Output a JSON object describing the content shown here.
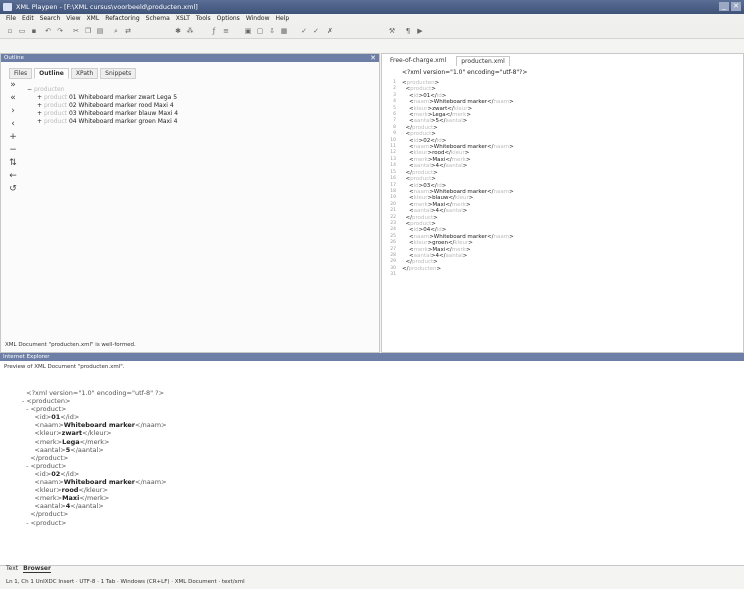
{
  "window": {
    "title": "XML Playpen - [F:\\XML cursus\\voorbeeld\\producten.xml]"
  },
  "menu": [
    "File",
    "Edit",
    "Search",
    "View",
    "XML",
    "Refactoring",
    "Schema",
    "XSLT",
    "Tools",
    "Options",
    "Window",
    "Help"
  ],
  "left_panel": {
    "title": "Outline",
    "tabs": [
      "Files",
      "Outline",
      "XPath",
      "Snippets"
    ],
    "active_tab": "Outline",
    "outline_root": "producten",
    "outline_items": [
      {
        "tag": "product",
        "text": "01 Whiteboard marker zwart Lega 5"
      },
      {
        "tag": "product",
        "text": "02 Whiteboard marker rood Maxi 4"
      },
      {
        "tag": "product",
        "text": "03 Whiteboard marker blauw Maxi 4"
      },
      {
        "tag": "product",
        "text": "04 Whiteboard marker groen Maxi 4"
      }
    ],
    "status": "XML Document \"producten.xml\" is well-formed."
  },
  "editor": {
    "tabs": [
      "Free-of-charge.xml",
      "producten.xml"
    ],
    "active_tab": "producten.xml",
    "header": "<?xml version=\"1.0\" encoding=\"utf-8\"?>",
    "lines": [
      [
        "",
        "",
        ""
      ],
      [
        "<",
        "producten",
        ">"
      ],
      [
        "  <",
        "product",
        ">"
      ],
      [
        "    <",
        "id",
        ">01</",
        "id",
        ">"
      ],
      [
        "    <",
        "naam",
        ">Whiteboard marker</",
        "naam",
        ">"
      ],
      [
        "    <",
        "kleur",
        ">zwart</",
        "kleur",
        ">"
      ],
      [
        "    <",
        "merk",
        ">Lega</",
        "merk",
        ">"
      ],
      [
        "    <",
        "aantal",
        ">5</",
        "aantal",
        ">"
      ],
      [
        "  </",
        "product",
        ">"
      ],
      [
        "  <",
        "product",
        ">"
      ],
      [
        "    <",
        "id",
        ">02</",
        "id",
        ">"
      ],
      [
        "    <",
        "naam",
        ">Whiteboard marker</",
        "naam",
        ">"
      ],
      [
        "    <",
        "kleur",
        ">rood</",
        "kleur",
        ">"
      ],
      [
        "    <",
        "merk",
        ">Maxi</",
        "merk",
        ">"
      ],
      [
        "    <",
        "aantal",
        ">4</",
        "aantal",
        ">"
      ],
      [
        "  </",
        "product",
        ">"
      ],
      [
        "  <",
        "product",
        ">"
      ],
      [
        "    <",
        "id",
        ">03</",
        "id",
        ">"
      ],
      [
        "    <",
        "naam",
        ">Whiteboard marker</",
        "naam",
        ">"
      ],
      [
        "    <",
        "kleur",
        ">blauw</",
        "kleur",
        ">"
      ],
      [
        "    <",
        "merk",
        ">Maxi</",
        "merk",
        ">"
      ],
      [
        "    <",
        "aantal",
        ">4</",
        "aantal",
        ">"
      ],
      [
        "  </",
        "product",
        ">"
      ],
      [
        "  <",
        "product",
        ">"
      ],
      [
        "    <",
        "id",
        ">04</",
        "id",
        ">"
      ],
      [
        "    <",
        "naam",
        ">Whiteboard marker</",
        "naam",
        ">"
      ],
      [
        "    <",
        "kleur",
        ">groen</",
        "kleur",
        ">"
      ],
      [
        "    <",
        "merk",
        ">Maxi</",
        "merk",
        ">"
      ],
      [
        "    <",
        "aantal",
        ">4</",
        "aantal",
        ">"
      ],
      [
        "  </",
        "product",
        ">"
      ],
      [
        "</",
        "producten",
        ">"
      ]
    ]
  },
  "browser": {
    "title": "Internet Explorer",
    "caption": "Preview of XML Document \"producten.xml\".",
    "lines": [
      {
        "pre": "  ",
        "plain": "<?xml version=\"1.0\" encoding=\"utf-8\" ?>",
        "bold": "",
        "post": ""
      },
      {
        "pre": "- ",
        "plain": "<producten>",
        "bold": "",
        "post": ""
      },
      {
        "pre": "  - ",
        "plain": "<product>",
        "bold": "",
        "post": ""
      },
      {
        "pre": "      ",
        "plain": "<id>",
        "bold": "01",
        "post": "</id>"
      },
      {
        "pre": "      ",
        "plain": "<naam>",
        "bold": "Whiteboard marker",
        "post": "</naam>"
      },
      {
        "pre": "      ",
        "plain": "<kleur>",
        "bold": "zwart",
        "post": "</kleur>"
      },
      {
        "pre": "      ",
        "plain": "<merk>",
        "bold": "Lega",
        "post": "</merk>"
      },
      {
        "pre": "      ",
        "plain": "<aantal>",
        "bold": "5",
        "post": "</aantal>"
      },
      {
        "pre": "    ",
        "plain": "</product>",
        "bold": "",
        "post": ""
      },
      {
        "pre": "  - ",
        "plain": "<product>",
        "bold": "",
        "post": ""
      },
      {
        "pre": "      ",
        "plain": "<id>",
        "bold": "02",
        "post": "</id>"
      },
      {
        "pre": "      ",
        "plain": "<naam>",
        "bold": "Whiteboard marker",
        "post": "</naam>"
      },
      {
        "pre": "      ",
        "plain": "<kleur>",
        "bold": "rood",
        "post": "</kleur>"
      },
      {
        "pre": "      ",
        "plain": "<merk>",
        "bold": "Maxi",
        "post": "</merk>"
      },
      {
        "pre": "      ",
        "plain": "<aantal>",
        "bold": "4",
        "post": "</aantal>"
      },
      {
        "pre": "    ",
        "plain": "</product>",
        "bold": "",
        "post": ""
      },
      {
        "pre": "  - ",
        "plain": "<product>",
        "bold": "",
        "post": ""
      }
    ],
    "tabs": [
      "Text",
      "Browser"
    ],
    "active_tab": "Browser"
  },
  "statusbar": "Ln 1, Ch 1    UnIXDC    Insert · UTF-8 · 1 Tab · Windows (CR+LF) · XML Document · text/xml",
  "icons": [
    "save-icon",
    "open-icon",
    "undo-icon",
    "redo-icon",
    "cut-icon",
    "copy-icon",
    "paste-icon",
    "check-icon",
    "close-icon"
  ]
}
